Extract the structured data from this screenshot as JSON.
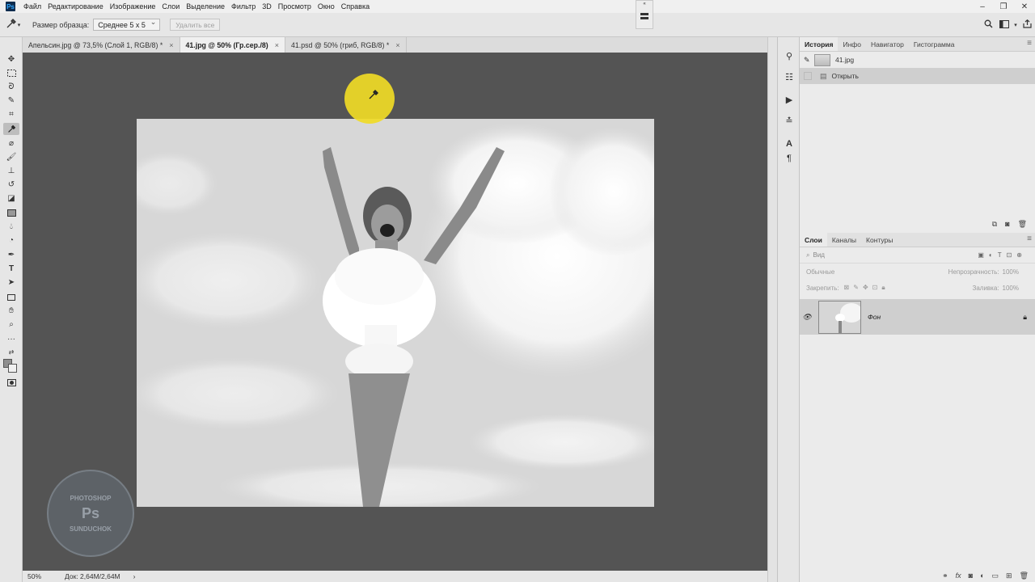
{
  "app": {
    "logo": "Ps"
  },
  "menu": [
    "Файл",
    "Редактирование",
    "Изображение",
    "Слои",
    "Выделение",
    "Фильтр",
    "3D",
    "Просмотр",
    "Окно",
    "Справка"
  ],
  "window_controls": [
    "–",
    "❐",
    "✕"
  ],
  "options": {
    "tool_icon": "eyedropper-icon",
    "sample_size_label": "Размер образца:",
    "sample_size_value": "Среднее 5 x 5",
    "clear_all_label": "Удалить все"
  },
  "doc_tabs": [
    {
      "label": "Апельсин.jpg @ 73,5% (Слой 1, RGB/8) *",
      "active": false
    },
    {
      "label": "41.jpg @ 50% (Гр.сер./8)",
      "active": true
    },
    {
      "label": "41.psd @ 50% (гриб, RGB/8) *",
      "active": false
    }
  ],
  "doc_tab_close": "×",
  "watermark": {
    "line1": "PHOTOSHOP",
    "logo": "Ps",
    "line2": "SUNDUCHOK"
  },
  "status": {
    "zoom": "50%",
    "doc_info": "Док: 2,64M/2,64M",
    "arrow": "›"
  },
  "history_panel": {
    "tabs": [
      "История",
      "Инфо",
      "Навигатор",
      "Гистограмма"
    ],
    "snapshot_label": "41.jpg",
    "entries": [
      "Открыть"
    ]
  },
  "layers_panel": {
    "tabs": [
      "Слои",
      "Каналы",
      "Контуры"
    ],
    "filter_placeholder": "Вид",
    "blend_mode": "Обычные",
    "opacity_label": "Непрозрачность:",
    "opacity_value": "100%",
    "lock_label": "Закрепить:",
    "fill_label": "Заливка:",
    "fill_value": "100%",
    "layers": [
      {
        "name": "Фон",
        "visible": true,
        "locked": true
      }
    ]
  },
  "colors": {
    "accent": "#f0db26",
    "canvas_bg": "#545454",
    "ps_blue": "#31a8ff"
  }
}
